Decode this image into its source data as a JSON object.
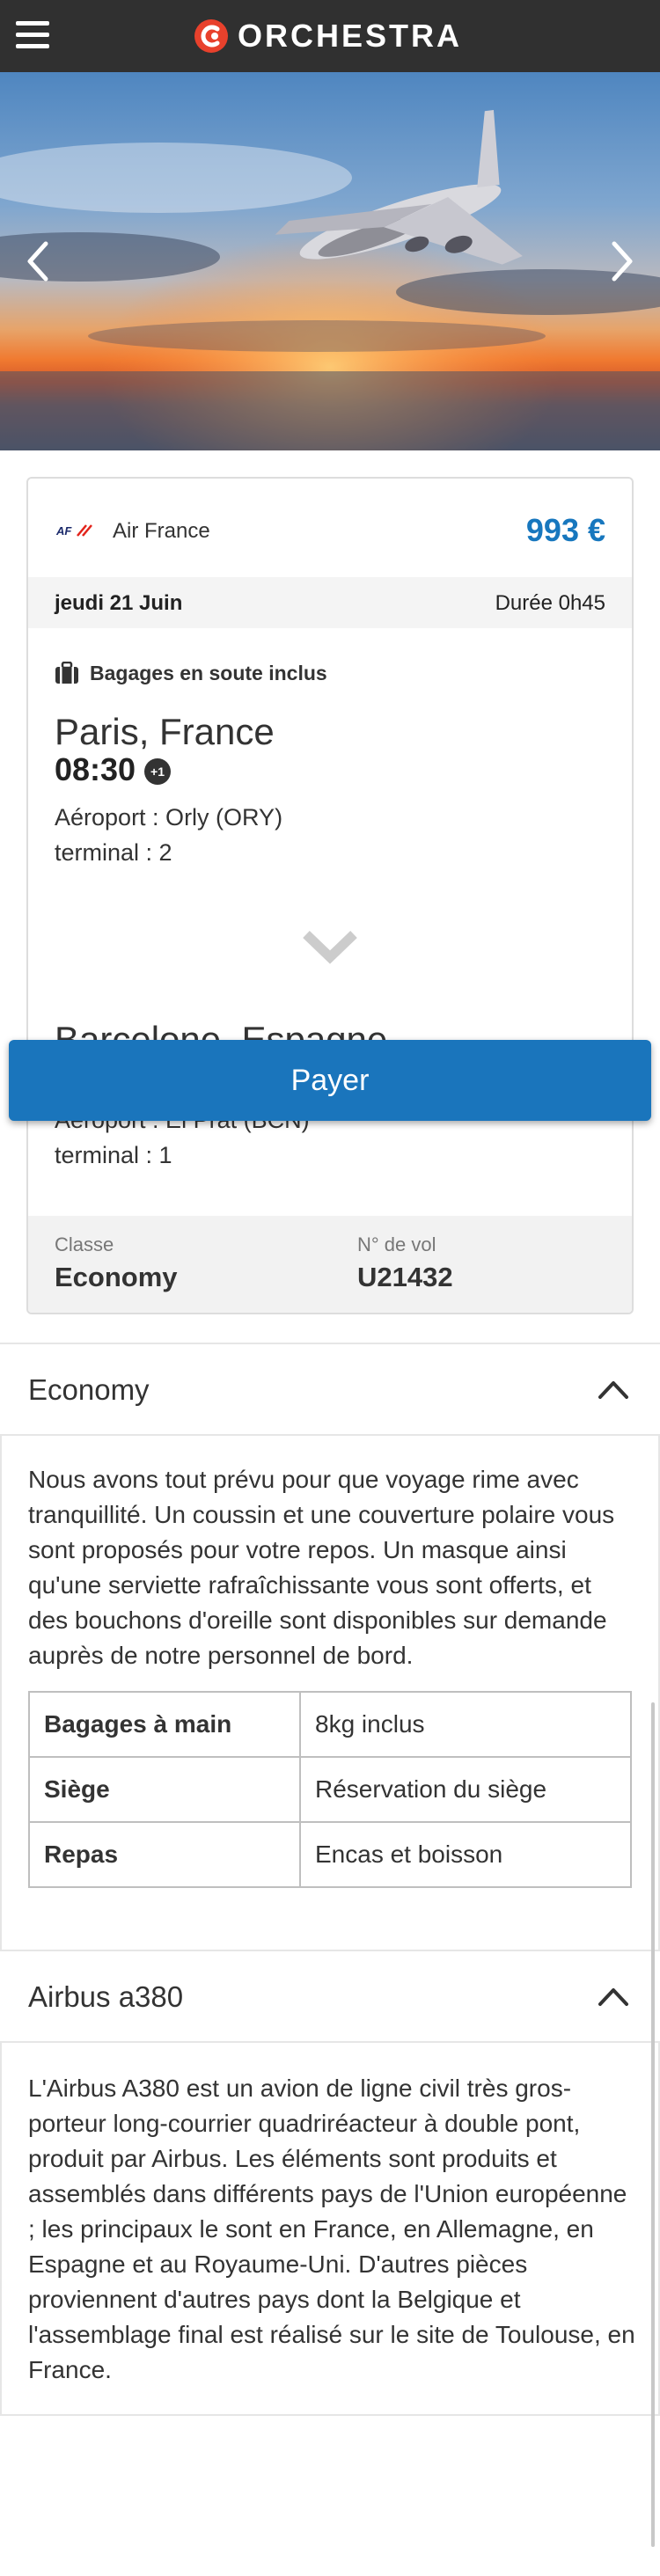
{
  "header": {
    "menu_icon": "hamburger-menu-icon",
    "brand": "ORCHESTRA",
    "logo_icon": "orchestra-logo-icon",
    "colors": {
      "bar": "#303030",
      "logo_red": "#e8412c"
    }
  },
  "hero": {
    "image": "airplane-sunset-photo",
    "prev_icon": "chevron-left-icon",
    "next_icon": "chevron-right-icon"
  },
  "flight": {
    "airline": "Air France",
    "airline_logo": "AF",
    "price": "993 €",
    "date": "jeudi 21 Juin",
    "duration": "Durée 0h45",
    "baggage": "Bagages en soute inclus",
    "departure": {
      "city": "Paris, France",
      "time": "08:30",
      "day_offset": "+1",
      "airport": "Aéroport : Orly (ORY)",
      "terminal": "terminal : 2"
    },
    "arrival": {
      "city": "Barcelone, Espagne",
      "airport": "Aéroport : El Prat (BCN)",
      "terminal": "terminal : 1"
    },
    "class_label": "Classe",
    "class_value": "Economy",
    "flight_no_label": "N° de vol",
    "flight_no_value": "U21432",
    "accent_color": "#1777be"
  },
  "pay_button": {
    "label": "Payer",
    "color": "#1a75bc"
  },
  "economy": {
    "title": "Economy",
    "description": "Nous avons tout prévu pour que voyage rime avec tranquillité. Un coussin et une couverture polaire vous sont proposés pour votre repos. Un masque ainsi qu'une serviette rafraîchissante vous sont offerts, et des bouchons d'oreille sont disponibles sur demande auprès de notre personnel de bord.",
    "specs": [
      {
        "label": "Bagages à main",
        "value": "8kg inclus"
      },
      {
        "label": "Siège",
        "value": "Réservation du siège"
      },
      {
        "label": "Repas",
        "value": "Encas et boisson"
      }
    ]
  },
  "aircraft": {
    "title": "Airbus a380",
    "description": "L'Airbus A380 est un avion de ligne civil très gros-porteur long-courrier quadriréacteur à double pont, produit par Airbus. Les éléments sont produits et assemblés dans différents pays de l'Union européenne ; les principaux le sont en France, en Allemagne, en Espagne et au Royaume-Uni. D'autres pièces proviennent d'autres pays dont la Belgique et l'assemblage final est réalisé sur le site de Toulouse, en France."
  }
}
